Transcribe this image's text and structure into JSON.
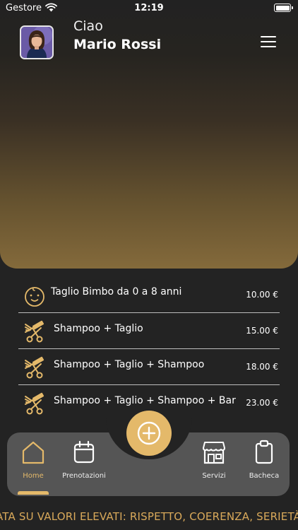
{
  "status_bar": {
    "carrier": "Gestore",
    "time": "12:19"
  },
  "header": {
    "greeting": "Ciao",
    "user_name": "Mario Rossi",
    "avatar_icon": "user-avatar",
    "menu_icon": "hamburger-menu-icon"
  },
  "services": [
    {
      "icon": "baby-face-icon",
      "name": "Taglio Bimbo da 0 a 8 anni",
      "price": "10.00 €"
    },
    {
      "icon": "scissors-comb-icon",
      "name": "Shampoo + Taglio",
      "price": "15.00 €"
    },
    {
      "icon": "scissors-comb-icon",
      "name": "Shampoo + Taglio + Shampoo",
      "price": "18.00 €"
    },
    {
      "icon": "scissors-comb-icon",
      "name": "Shampoo + Taglio + Shampoo + Bar",
      "price": "23.00 €"
    }
  ],
  "tab_bar": {
    "fab_icon": "plus-circle-icon",
    "tabs": [
      {
        "icon": "home-icon",
        "label": "Home",
        "active": true
      },
      {
        "icon": "calendar-icon",
        "label": "Prenotazioni",
        "active": false
      },
      {
        "icon": "store-icon",
        "label": "Servizi",
        "active": false
      },
      {
        "icon": "clipboard-icon",
        "label": "Bacheca",
        "active": false
      }
    ]
  },
  "marquee": {
    "text": "ATA SU VALORI ELEVATI: RISPETTO, COERENZA, SERIETÀ, "
  },
  "colors": {
    "accent": "#e4b96a",
    "background": "#232323",
    "tab_bar": "#555555"
  }
}
